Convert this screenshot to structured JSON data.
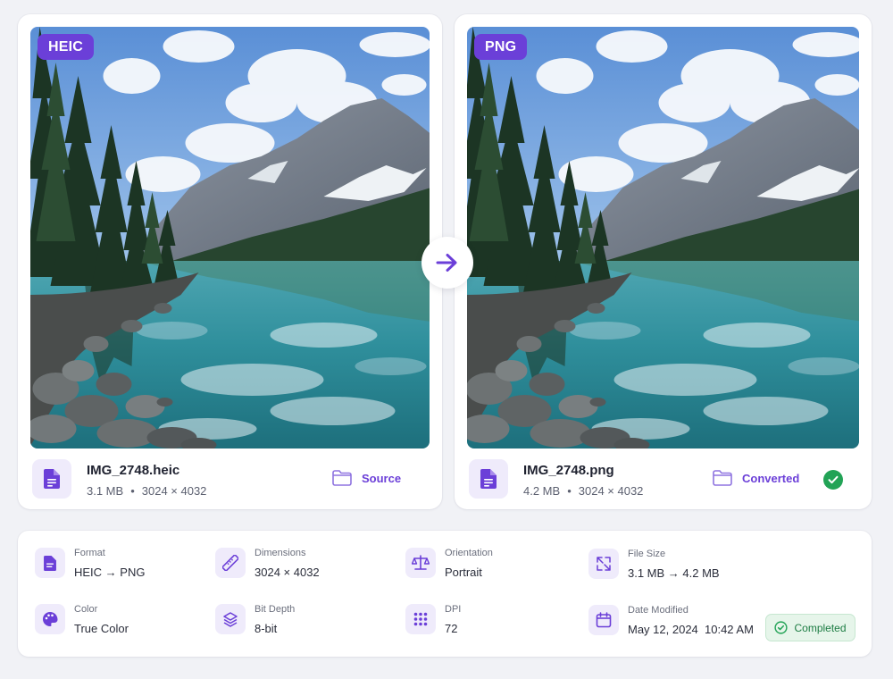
{
  "source": {
    "format_badge": "HEIC",
    "file_name": "IMG_2748.heic",
    "file_size": "3.1 MB",
    "dimensions": "3024 × 4032",
    "folder_label": "Source"
  },
  "converted": {
    "format_badge": "PNG",
    "file_name": "IMG_2748.png",
    "file_size": "4.2 MB",
    "dimensions": "3024 × 4032",
    "folder_label": "Converted",
    "status_icon": "check-circle-icon"
  },
  "meta_separator": "•",
  "details": {
    "format": {
      "label": "Format",
      "value": "HEIC → PNG",
      "icon": "file-icon"
    },
    "dimensions": {
      "label": "Dimensions",
      "value": "3024 × 4032",
      "icon": "ruler-icon"
    },
    "orientation": {
      "label": "Orientation",
      "value": "Portrait",
      "icon": "balance-scale-icon"
    },
    "file_size": {
      "label": "File Size",
      "value": "3.1 MB → 4.2 MB",
      "icon": "expand-icon"
    },
    "color": {
      "label": "Color",
      "value": "True Color",
      "icon": "palette-icon"
    },
    "bit_depth": {
      "label": "Bit Depth",
      "value": "8-bit",
      "icon": "layers-icon"
    },
    "dpi": {
      "label": "DPI",
      "value": "72",
      "icon": "grid-dots-icon"
    },
    "date_modified": {
      "label": "Date Modified",
      "value": "May 12, 2024  10:42 AM",
      "icon": "calendar-icon"
    }
  },
  "status": {
    "label": "Completed",
    "icon": "check-circle-outline-icon"
  },
  "colors": {
    "accent": "#6b3fd8",
    "accent_soft": "#efebfb",
    "success": "#22a356",
    "success_soft": "#e6f5ea",
    "page_bg": "#f1f2f6"
  }
}
